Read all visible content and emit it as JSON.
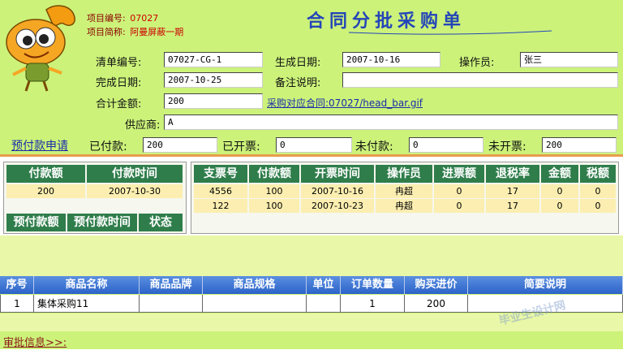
{
  "header": {
    "project_no_label": "项目编号:",
    "project_no": "07027",
    "project_name_label": "项目简称:",
    "project_name": "阿曼屏蔽一期",
    "title": "合同分批采购单"
  },
  "form": {
    "order_no_label": "清单编号:",
    "order_no": "07027-CG-1",
    "gen_date_label": "生成日期:",
    "gen_date": "2007-10-16",
    "operator_label": "操作员:",
    "operator": "张三",
    "done_date_label": "完成日期:",
    "done_date": "2007-10-25",
    "remark_label": "备注说明:",
    "remark": "",
    "total_label": "合计金额:",
    "total": "200",
    "contract_link": "采购对应合同:07027/head_bar.gif",
    "supplier_label": "供应商:",
    "supplier": "A"
  },
  "payment_bar": {
    "apply_link": "预付款申请",
    "paid_label": "已付款:",
    "paid": "200",
    "invoiced_label": "已开票:",
    "invoiced": "0",
    "unpaid_label": "未付款:",
    "unpaid": "0",
    "uninvoiced_label": "未开票:",
    "uninvoiced": "200"
  },
  "payments": {
    "headers": [
      "付款额",
      "付款时间"
    ],
    "rows": [
      [
        "200",
        "2007-10-30"
      ]
    ],
    "prepay_headers": [
      "预付款额",
      "预付款时间",
      "状态"
    ]
  },
  "invoices": {
    "headers": [
      "支票号",
      "付款额",
      "开票时间",
      "操作员",
      "进票额",
      "退税率",
      "金额",
      "税额"
    ],
    "rows": [
      [
        "4556",
        "100",
        "2007-10-16",
        "冉超",
        "0",
        "17",
        "0",
        "0"
      ],
      [
        "122",
        "100",
        "2007-10-23",
        "冉超",
        "0",
        "17",
        "0",
        "0"
      ]
    ]
  },
  "goods": {
    "headers": [
      "序号",
      "商品名称",
      "商品品牌",
      "商品规格",
      "单位",
      "订单数量",
      "购买进价",
      "简要说明"
    ],
    "rows": [
      [
        "1",
        "集体采购11",
        "",
        "",
        "",
        "1",
        "200",
        ""
      ]
    ]
  },
  "approval_link": "审批信息>>:",
  "watermark": "毕业生设计网",
  "colors": {
    "top_bg": "#ccf27a",
    "green_header": "#2f7d4b",
    "blue_header": "#2c63c8",
    "title": "#2446b8",
    "cell_bg": "#fbeeb0",
    "divider": "#e89c4c"
  }
}
